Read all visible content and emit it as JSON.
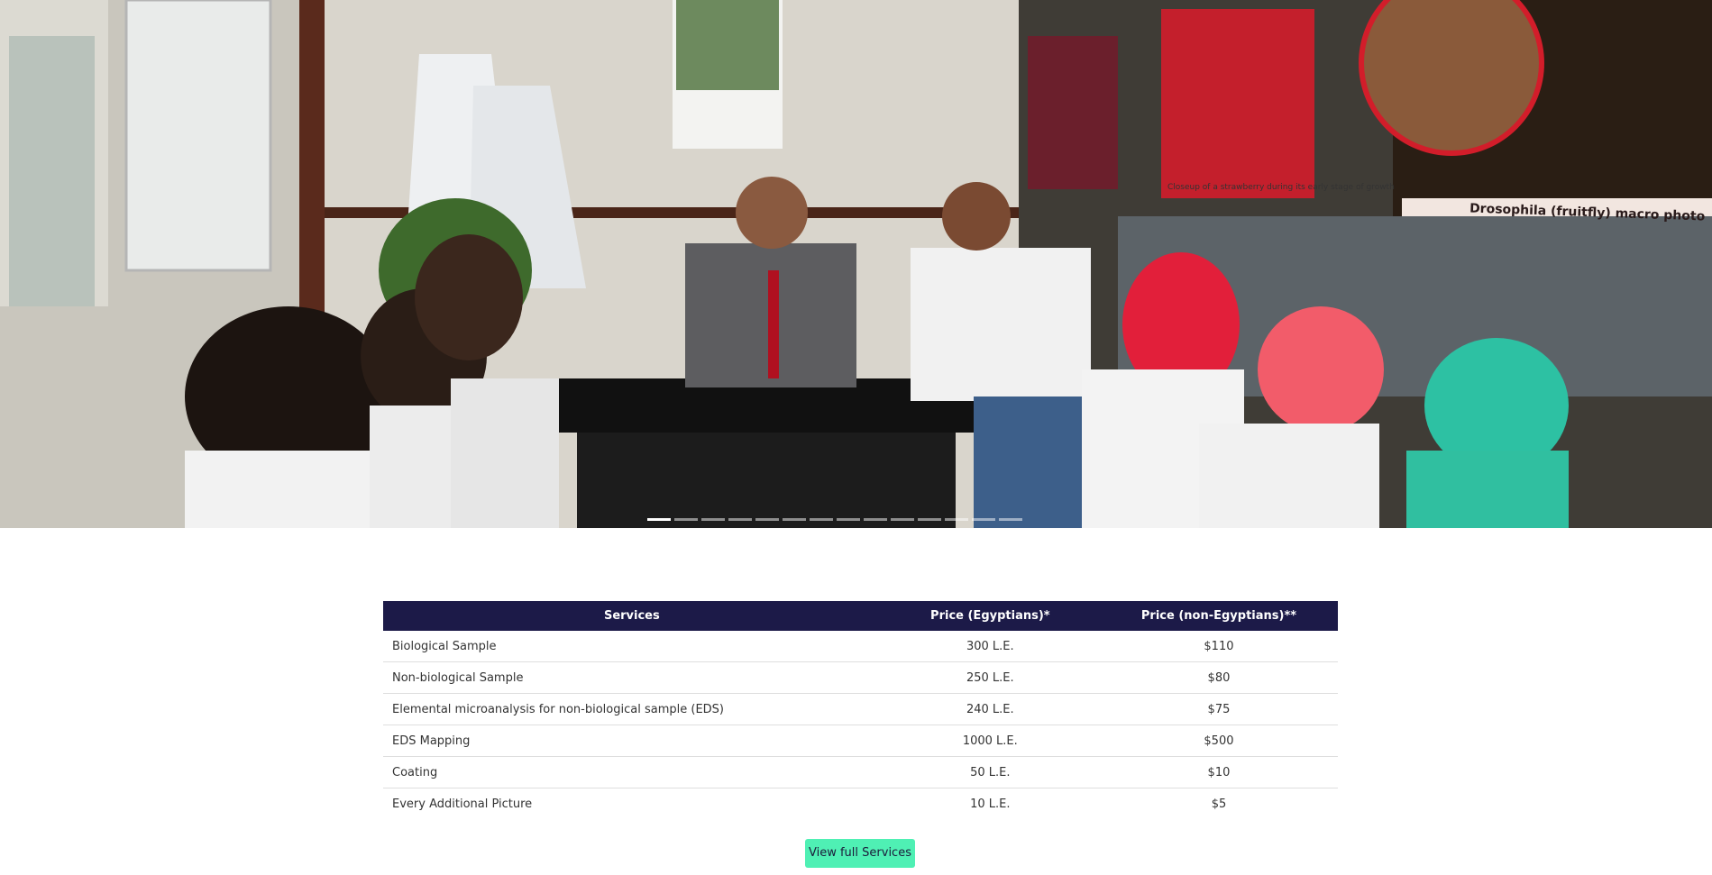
{
  "hero": {
    "strawberry_caption": "Closeup of a strawberry during its early stage of growth",
    "fly_caption": "Drosophila (fruitfly) macro photo",
    "slide_count": 14,
    "active_slide": 1
  },
  "services_table": {
    "headers": {
      "service": "Services",
      "price_egyptians": "Price (Egyptians)*",
      "price_non_egyptians": "Price (non-Egyptians)**"
    },
    "rows": [
      {
        "service": "Biological Sample",
        "price_egyptians": "300 L.E.",
        "price_non_egyptians": "$110"
      },
      {
        "service": "Non-biological Sample",
        "price_egyptians": "250 L.E.",
        "price_non_egyptians": "$80"
      },
      {
        "service": "Elemental microanalysis for non-biological sample (EDS)",
        "price_egyptians": "240 L.E.",
        "price_non_egyptians": "$75"
      },
      {
        "service": "EDS Mapping",
        "price_egyptians": "1000 L.E.",
        "price_non_egyptians": "$500"
      },
      {
        "service": "Coating",
        "price_egyptians": "50 L.E.",
        "price_non_egyptians": "$10"
      },
      {
        "service": "Every Additional Picture",
        "price_egyptians": "10 L.E.",
        "price_non_egyptians": "$5"
      }
    ]
  },
  "view_full_services_label": "View full Services",
  "colors": {
    "table_header_bg": "#1c1a48",
    "button_bg": "#4ff0b4"
  }
}
